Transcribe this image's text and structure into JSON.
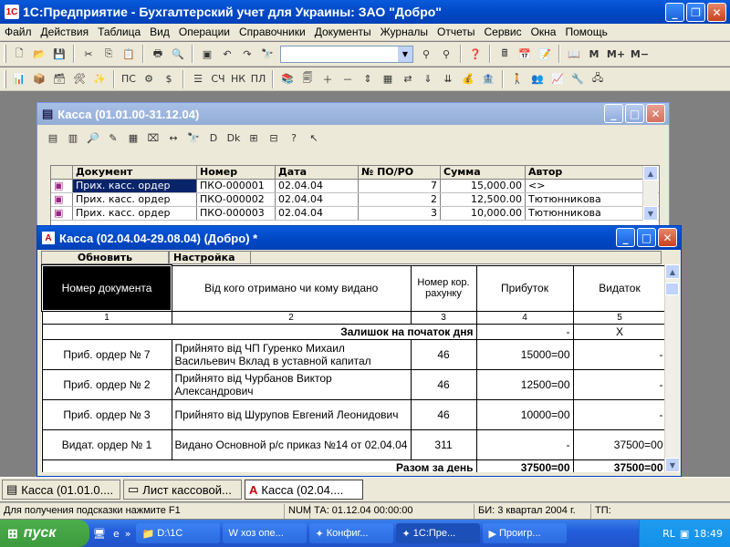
{
  "app": {
    "title": "1С:Предприятие - Бухгалтерский учет для Украины: ЗАО \"Добро\""
  },
  "menu": [
    "Файл",
    "Действия",
    "Таблица",
    "Вид",
    "Операции",
    "Справочники",
    "Документы",
    "Журналы",
    "Отчеты",
    "Сервис",
    "Окна",
    "Помощь"
  ],
  "toolbar": {
    "m_label": "M",
    "mplus_label": "M+",
    "mminus_label": "M−"
  },
  "journal": {
    "title": "Касса (01.01.00-31.12.04)",
    "headers": [
      "Документ",
      "Номер",
      "Дата",
      "№ ПО/РО",
      "Сумма",
      "Автор"
    ],
    "rows": [
      {
        "doc": "Прих. касс. ордер",
        "num": "ПКО-000001",
        "date": "02.04.04",
        "po": "7",
        "sum": "15,000.00",
        "author": "<>"
      },
      {
        "doc": "Прих. касс. ордер",
        "num": "ПКО-000002",
        "date": "02.04.04",
        "po": "2",
        "sum": "12,500.00",
        "author": "Тютюнникова"
      },
      {
        "doc": "Прих. касс. ордер",
        "num": "ПКО-000003",
        "date": "02.04.04",
        "po": "3",
        "sum": "10,000.00",
        "author": "Тютюнникова"
      }
    ]
  },
  "report": {
    "title": "Касса (02.04.04-29.08.04) (Добро)  *",
    "tab_refresh": "Обновить",
    "tab_settings": "Настройка",
    "col_doc": "Номер документа",
    "col_from": "Від кого отримано чи кому видано",
    "col_acct": "Номер кор. рахунку",
    "col_in": "Прибуток",
    "col_out": "Видаток",
    "colnums": [
      "1",
      "2",
      "3",
      "4",
      "5"
    ],
    "opening_label": "Залишок на початок дня",
    "opening_in": "-",
    "opening_out": "X",
    "rows": [
      {
        "doc": "Приб. ордер № 7",
        "desc": "Прийнято від ЧП Гуренко Михаил Васильевич Вклад в уставной капитал",
        "acct": "46",
        "in": "15000=00",
        "out": "-"
      },
      {
        "doc": "Приб. ордер № 2",
        "desc": "Прийнято від Чурбанов Виктор Александрович",
        "acct": "46",
        "in": "12500=00",
        "out": "-"
      },
      {
        "doc": "Приб. ордер № 3",
        "desc": "Прийнято від Шурупов Евгений Леонидович",
        "acct": "46",
        "in": "10000=00",
        "out": "-"
      },
      {
        "doc": "Видат. ордер № 1",
        "desc": "Видано Основной р/с приказ №14 от 02.04.04",
        "acct": "311",
        "in": "-",
        "out": "37500=00"
      }
    ],
    "total_label": "Разом за день",
    "total_in": "37500=00",
    "total_out": "37500=00"
  },
  "mdi_windows": [
    "Касса (01.01.0....",
    "Лист кассовой...",
    "Касса (02.04...."
  ],
  "status": {
    "hint": "Для получения подсказки нажмите F1",
    "num": "NUM",
    "ta": "ТА: 01.12.04  00:00:00",
    "bi": "БИ: 3 квартал 2004 г.",
    "tp": "ТП:"
  },
  "taskbar": {
    "start": "пуск",
    "tasks": [
      "D:\\1С",
      "хоз опе...",
      "Конфиг...",
      "1С:Пре...",
      "Проигр..."
    ],
    "lang": "RL",
    "clock": "18:49"
  },
  "colors": {
    "xp_blue": "#0049c6",
    "start_green": "#3c9a3c",
    "face": "#ece9d8"
  }
}
